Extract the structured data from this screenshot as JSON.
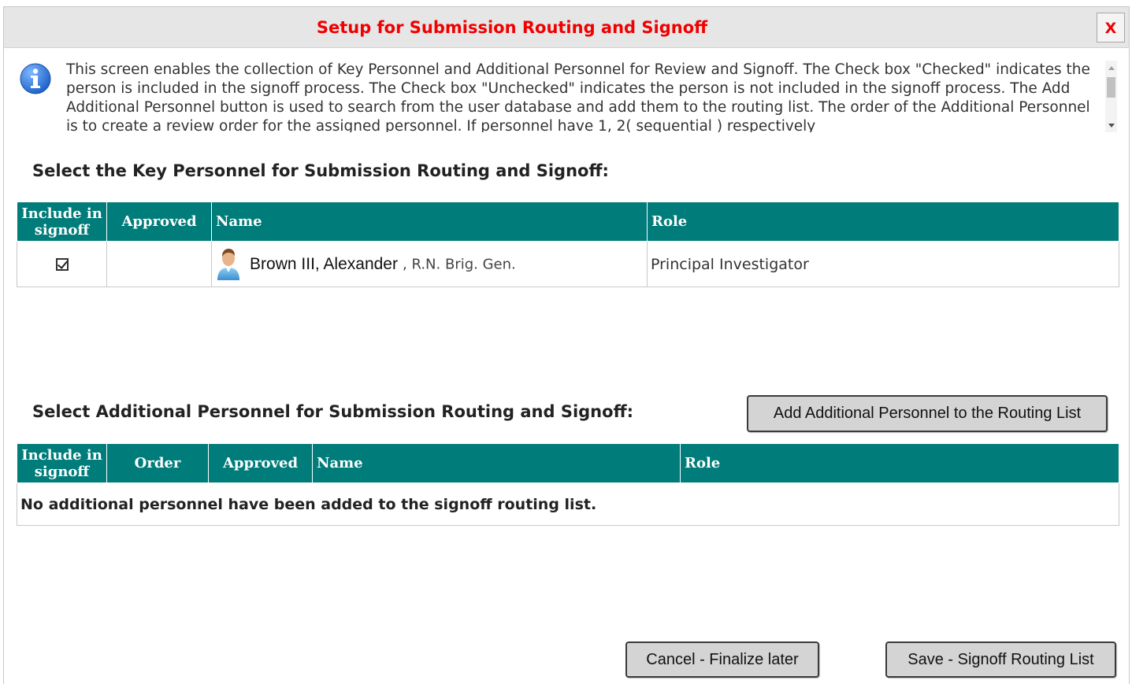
{
  "dialog": {
    "title": "Setup for Submission Routing and Signoff",
    "close_label": "X",
    "info_text": "This screen enables the collection of Key Personnel and Additional Personnel for Review and Signoff. The Check box \"Checked\" indicates the person is included in the signoff process. The Check box \"Unchecked\" indicates the person is not included in the signoff process. The Add Additional Personnel button is used to search from the user database and add them to the routing list. The order of the Additional Personnel is to create a review order for the assigned personnel. If personnel have 1, 2( sequential ) respectively"
  },
  "key_personnel": {
    "heading": "Select the Key Personnel for Submission Routing and Signoff:",
    "columns": {
      "include": "Include in signoff",
      "approved": "Approved",
      "name": "Name",
      "role": "Role"
    },
    "rows": [
      {
        "included": true,
        "approved": "",
        "name": "Brown III, Alexander",
        "suffix": ", R.N. Brig. Gen.",
        "role": "Principal Investigator"
      }
    ]
  },
  "additional_personnel": {
    "heading": "Select Additional Personnel for Submission Routing and Signoff:",
    "add_button": "Add Additional Personnel to the Routing List",
    "columns": {
      "include": "Include in signoff",
      "order": "Order",
      "approved": "Approved",
      "name": "Name",
      "role": "Role"
    },
    "empty_message": "No additional personnel have been added to the signoff routing list."
  },
  "footer": {
    "cancel_label": "Cancel - Finalize later",
    "save_label": "Save - Signoff Routing List"
  },
  "colors": {
    "title": "#f00000",
    "header_teal": "#007c7a",
    "titlebar_bg": "#e6e6e6",
    "button_bg": "#d4d4d4"
  }
}
